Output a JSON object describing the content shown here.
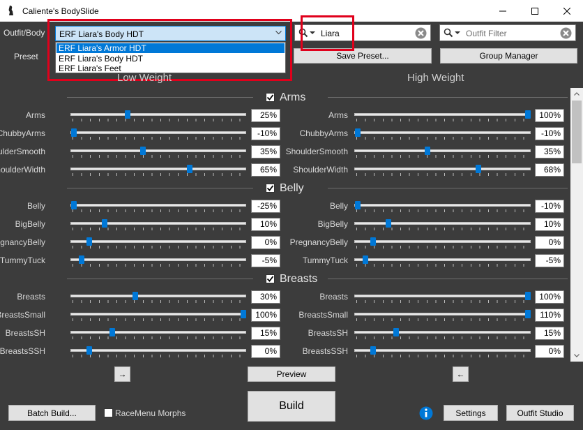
{
  "window": {
    "title": "Caliente's BodySlide"
  },
  "header": {
    "outfit_label": "Outfit/Body",
    "preset_label": "Preset",
    "outfit_value": "ERF Liara's Body HDT",
    "outfit_options": [
      "ERF Liara's Armor HDT",
      "ERF Liara's Body HDT",
      "ERF Liara's Feet"
    ],
    "outfit_search": "Liara",
    "outfit_filter_placeholder": "Outfit Filter",
    "save_preset": "Save Preset...",
    "group_manager": "Group Manager"
  },
  "columns": {
    "low": "Low Weight",
    "high": "High Weight"
  },
  "groups": [
    {
      "name": "Arms",
      "sliders": [
        {
          "name": "Arms",
          "low": 25,
          "low_text": "25%",
          "high": 100,
          "high_text": "100%"
        },
        {
          "name": "ChubbyArms",
          "low": -10,
          "low_text": "-10%",
          "high": -10,
          "high_text": "-10%"
        },
        {
          "name": "ShoulderSmooth",
          "low": 35,
          "low_text": "35%",
          "high": 35,
          "high_text": "35%"
        },
        {
          "name": "ShoulderWidth",
          "low": 65,
          "low_text": "65%",
          "high": 68,
          "high_text": "68%"
        }
      ]
    },
    {
      "name": "Belly",
      "sliders": [
        {
          "name": "Belly",
          "low": -25,
          "low_text": "-25%",
          "high": -10,
          "high_text": "-10%"
        },
        {
          "name": "BigBelly",
          "low": 10,
          "low_text": "10%",
          "high": 10,
          "high_text": "10%"
        },
        {
          "name": "PregnancyBelly",
          "low": 0,
          "low_text": "0%",
          "high": 0,
          "high_text": "0%"
        },
        {
          "name": "TummyTuck",
          "low": -5,
          "low_text": "-5%",
          "high": -5,
          "high_text": "-5%"
        }
      ]
    },
    {
      "name": "Breasts",
      "sliders": [
        {
          "name": "Breasts",
          "low": 30,
          "low_text": "30%",
          "high": 100,
          "high_text": "100%"
        },
        {
          "name": "BreastsSmall",
          "low": 100,
          "low_text": "100%",
          "high": 110,
          "high_text": "110%"
        },
        {
          "name": "BreastsSH",
          "low": 15,
          "low_text": "15%",
          "high": 15,
          "high_text": "15%"
        },
        {
          "name": "BreastsSSH",
          "low": 0,
          "low_text": "0%",
          "high": 0,
          "high_text": "0%"
        }
      ]
    }
  ],
  "bottom": {
    "copy_left": "→",
    "copy_right": "←",
    "preview": "Preview",
    "build": "Build",
    "batch_build": "Batch Build...",
    "racemenu_morphs": "RaceMenu Morphs",
    "settings": "Settings",
    "outfit_studio": "Outfit Studio"
  },
  "colors": {
    "background": "#3c3c3c",
    "accent": "#0078d7",
    "highlight_box": "#e0001b"
  }
}
